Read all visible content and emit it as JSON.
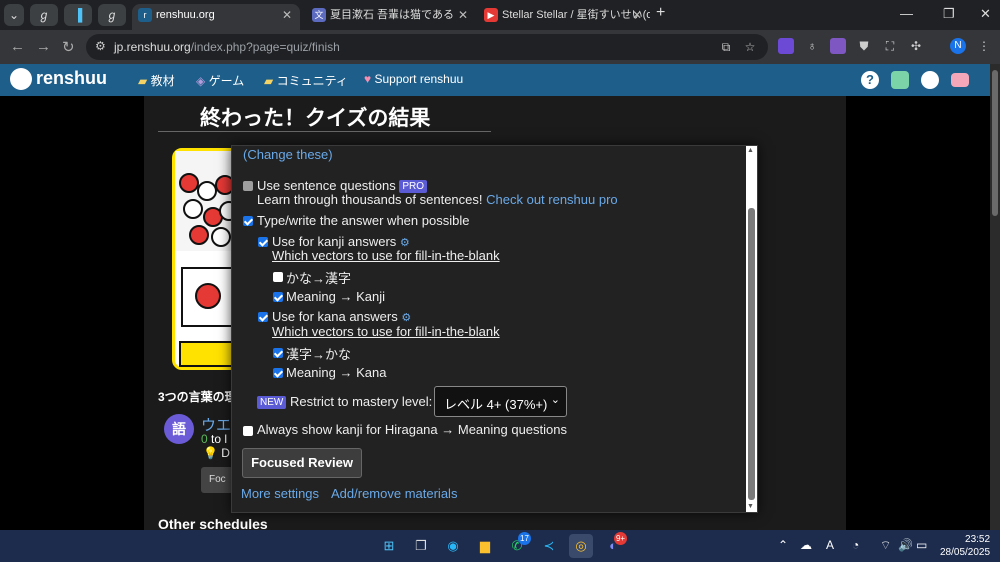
{
  "browser": {
    "tabs": [
      {
        "title": "renshuu.org"
      },
      {
        "title": "夏目漱石 吾輩は猫である"
      },
      {
        "title": "Stellar Stellar / 星街すいせい(offi"
      }
    ],
    "new_tab": "+",
    "url_domain": "jp.renshuu.org",
    "url_path": "/index.php?page=quiz/finish"
  },
  "site": {
    "logo": "renshuu",
    "menu": [
      "教材",
      "ゲーム",
      "コミュニティ",
      "Support renshuu"
    ]
  },
  "page": {
    "title": "終わった！クイズの結果",
    "section_heading": "3つの言葉の理",
    "avatar_char": "語",
    "word_partial": "ウエ",
    "progress_partial": "0",
    "progress_text": "to l",
    "tip_partial": "D",
    "focus_btn_partial": "Foc",
    "other_heading": "Other schedules"
  },
  "popup": {
    "change_link": "(Change these)",
    "sentence_label": "Use sentence questions",
    "pro_badge": "PRO",
    "sentence_note": "Learn through thousands of sentences!",
    "pro_link": "Check out renshuu pro",
    "type_label": "Type/write the answer when possible",
    "kanji_label": "Use for kanji answers",
    "vectors_link": "Which vectors to use for fill-in-the-blank",
    "kana_to_kanji": "かな→漢字",
    "meaning_to_kanji": "Meaning → Kanji",
    "kana_label": "Use for kana answers",
    "vectors_link2": "Which vectors to use for fill-in-the-blank",
    "kanji_to_kana": "漢字→かな",
    "meaning_to_kana": "Meaning → Kana",
    "new_badge": "NEW",
    "restrict_label": "Restrict to mastery level:",
    "mastery_value": "レベル 4+ (37%+)",
    "always_kanji_label": "Always show kanji for Hiragana → Meaning questions",
    "focused_review_btn": "Focused Review",
    "more_settings": "More settings",
    "add_remove": "Add/remove materials"
  },
  "taskbar": {
    "whatsapp_badge": "17",
    "discord_badge": "9+",
    "time": "23:52",
    "date": "28/05/2025"
  },
  "colors": {
    "site_header": "#1e5e8a",
    "link": "#6aa9e8",
    "checkbox_on": "#1a73e8",
    "badge": "#5b5bd6"
  }
}
